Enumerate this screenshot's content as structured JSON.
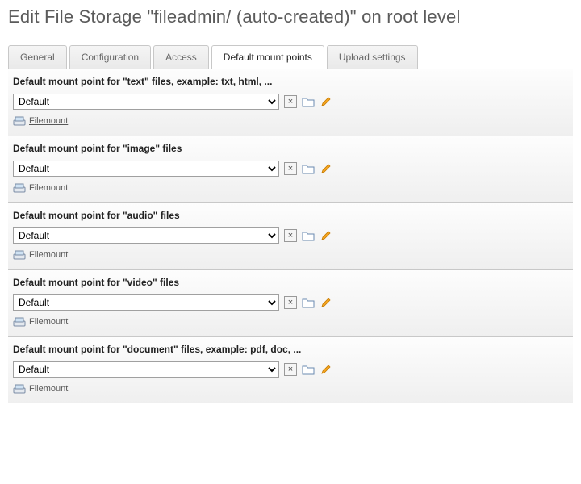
{
  "header": {
    "title": "Edit File Storage \"fileadmin/ (auto-created)\" on root level"
  },
  "tabs": [
    {
      "label": "General"
    },
    {
      "label": "Configuration"
    },
    {
      "label": "Access"
    },
    {
      "label": "Default mount points"
    },
    {
      "label": "Upload settings"
    }
  ],
  "active_tab_index": 3,
  "select_options": [
    "Default"
  ],
  "filemount_label": "Filemount",
  "sections": [
    {
      "title": "Default mount point for \"text\" files, example: txt, html, ...",
      "value": "Default",
      "link_underline": true
    },
    {
      "title": "Default mount point for \"image\" files",
      "value": "Default",
      "link_underline": false
    },
    {
      "title": "Default mount point for \"audio\" files",
      "value": "Default",
      "link_underline": false
    },
    {
      "title": "Default mount point for \"video\" files",
      "value": "Default",
      "link_underline": false
    },
    {
      "title": "Default mount point for \"document\" files, example: pdf, doc, ...",
      "value": "Default",
      "link_underline": false
    }
  ]
}
